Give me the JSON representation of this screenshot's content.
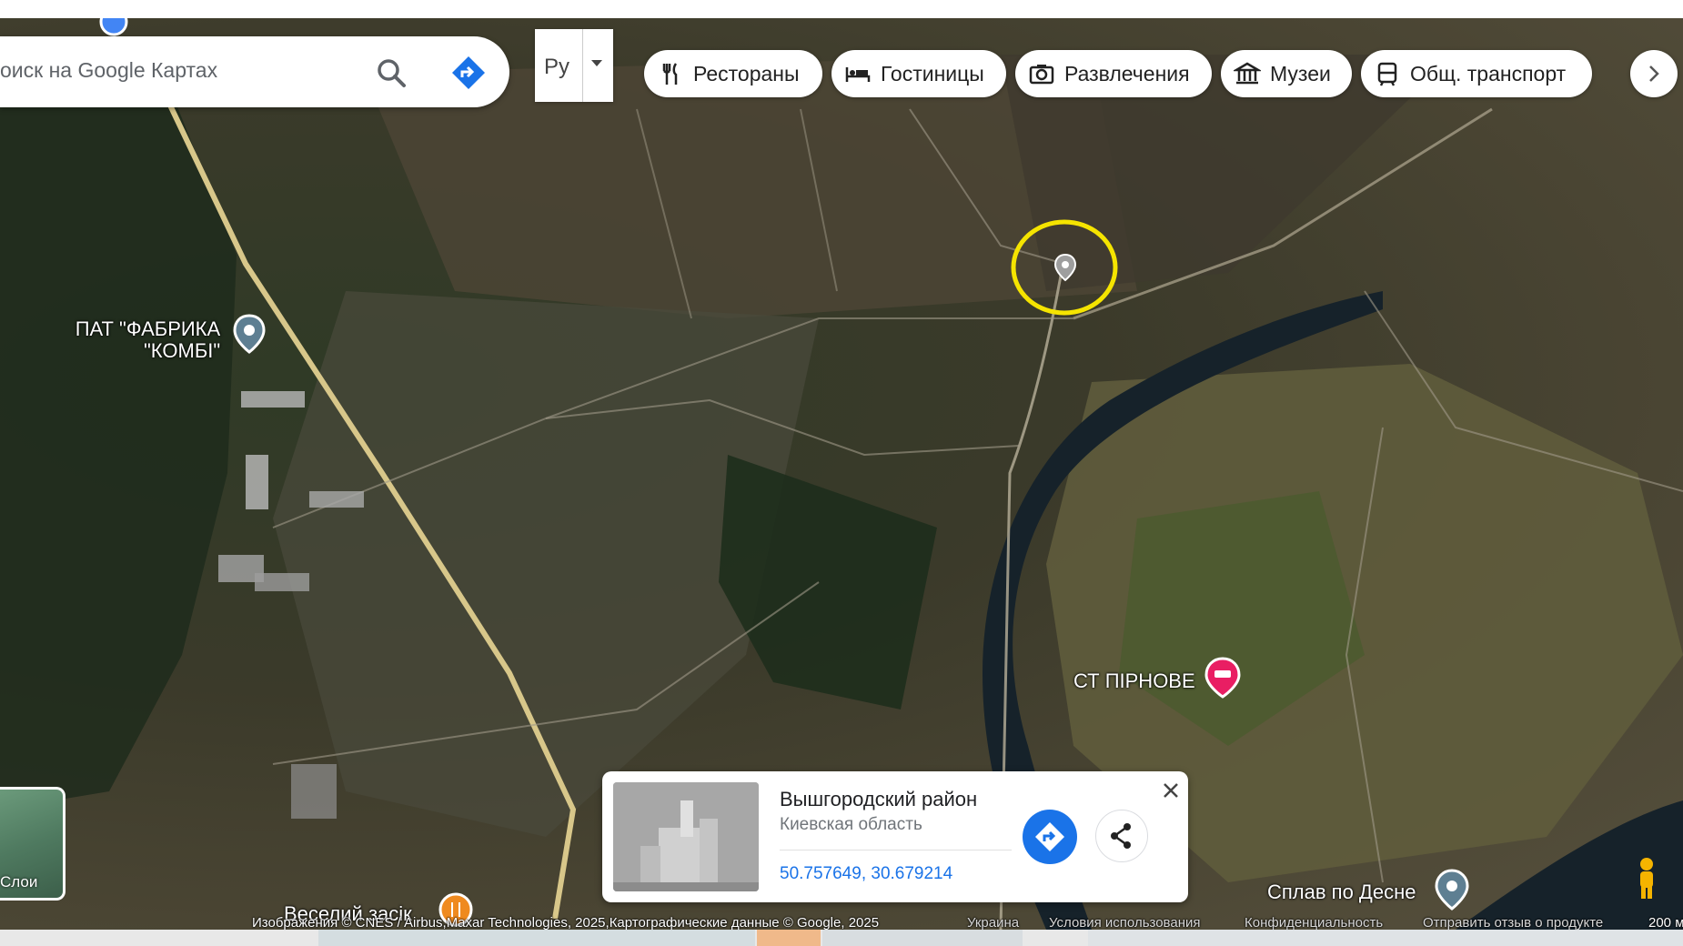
{
  "search": {
    "placeholder": "оиск на Google Картах",
    "search_icon": "search-icon",
    "directions_icon": "directions-icon"
  },
  "language": {
    "label": "Ру"
  },
  "chips": [
    {
      "label": "Рестораны",
      "icon": "restaurant-icon"
    },
    {
      "label": "Гостиницы",
      "icon": "hotel-icon"
    },
    {
      "label": "Развлечения",
      "icon": "camera-icon"
    },
    {
      "label": "Музеи",
      "icon": "museum-icon"
    },
    {
      "label": "Общ. транспорт",
      "icon": "transit-icon"
    }
  ],
  "places": {
    "factory": "ПАТ \"ФАБРИКА \"КОМБІ\"",
    "factory_line1": "ПАТ \"ФАБРИКА",
    "factory_line2": "\"КОМБІ\"",
    "st_pirnove": "СТ ПІРНОВЕ",
    "splav": "Сплав по Десне",
    "veselyi": "Веселий засік"
  },
  "place_card": {
    "title": "Вышгородский район",
    "subtitle": "Киевская область",
    "coordinates": "50.757649, 30.679214"
  },
  "layers": {
    "label": "Слои"
  },
  "attribution": {
    "imagery": "Изображения © CNES / Airbus,Maxar Technologies, 2025,Картографические данные © Google, 2025",
    "country": "Украина",
    "terms": "Условия использования",
    "privacy": "Конфиденциальность",
    "feedback": "Отправить отзыв о продукте",
    "scale": "200 м"
  },
  "colors": {
    "highlight_circle": "#f5e400",
    "accent_blue": "#1a73e8",
    "hotel_pin": "#e91e63"
  }
}
